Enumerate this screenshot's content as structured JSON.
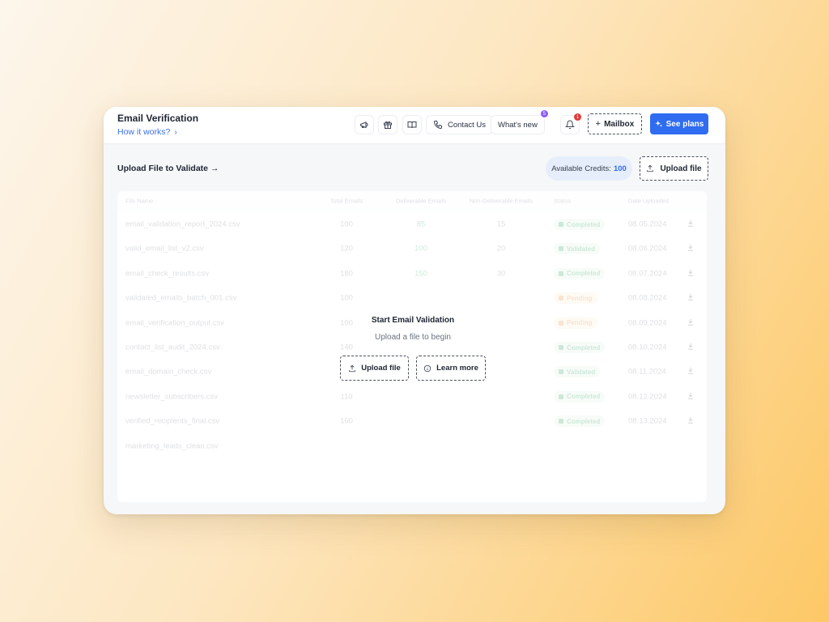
{
  "header": {
    "title": "Email Verification",
    "how_it_works": "How it works?",
    "contact_us": "Contact Us",
    "whats_new": "What's new",
    "whats_new_badge": "5",
    "notifications_badge": "1",
    "mailbox": "Mailbox",
    "see_plans": "See plans"
  },
  "toolbar": {
    "section_title": "Upload File to Validate →",
    "credits_label": "Available Credits:",
    "credits_value": "100",
    "upload_file": "Upload file"
  },
  "table": {
    "columns": [
      "File Name",
      "Total Emails",
      "Deliverable Emails",
      "Non-Deliverable Emails",
      "Status",
      "Date Uploaded",
      ""
    ],
    "rows": [
      {
        "name": "email_validation_report_2024.csv",
        "total": "100",
        "deliverable": "85",
        "non_deliverable": "15",
        "status": "Completed",
        "status_color": "green",
        "date": "08.05.2024"
      },
      {
        "name": "valid_email_list_v2.csv",
        "total": "120",
        "deliverable": "100",
        "non_deliverable": "20",
        "status": "Validated",
        "status_color": "green",
        "date": "08.06.2024"
      },
      {
        "name": "email_check_results.csv",
        "total": "180",
        "deliverable": "150",
        "non_deliverable": "30",
        "status": "Completed",
        "status_color": "green",
        "date": "08.07.2024"
      },
      {
        "name": "validated_emails_batch_001.csv",
        "total": "100",
        "deliverable": "",
        "non_deliverable": "",
        "status": "Pending",
        "status_color": "orange",
        "date": "08.08.2024"
      },
      {
        "name": "email_verification_output.csv",
        "total": "100",
        "deliverable": "",
        "non_deliverable": "",
        "status": "Pending",
        "status_color": "orange",
        "date": "08.09.2024"
      },
      {
        "name": "contact_list_audit_2024.csv",
        "total": "140",
        "deliverable": "",
        "non_deliverable": "",
        "status": "Completed",
        "status_color": "green",
        "date": "08.10.2024"
      },
      {
        "name": "email_domain_check.csv",
        "total": "150",
        "deliverable": "",
        "non_deliverable": "",
        "status": "Validated",
        "status_color": "green",
        "date": "08.11.2024"
      },
      {
        "name": "newsletter_subscribers.csv",
        "total": "110",
        "deliverable": "",
        "non_deliverable": "",
        "status": "Completed",
        "status_color": "green",
        "date": "08.12.2024"
      },
      {
        "name": "verified_recipients_final.csv",
        "total": "160",
        "deliverable": "",
        "non_deliverable": "",
        "status": "Completed",
        "status_color": "green",
        "date": "08.13.2024"
      },
      {
        "name": "marketing_leads_clean.csv",
        "total": "",
        "deliverable": "",
        "non_deliverable": "",
        "status": "",
        "status_color": "green",
        "date": ""
      }
    ]
  },
  "empty_state": {
    "title": "Start Email Validation",
    "subtitle": "Upload a file to begin",
    "upload_button": "Upload file",
    "learn_more_button": "Learn more"
  },
  "colors": {
    "accent": "#2f6cf0",
    "success": "#1f9a52",
    "pending": "#e08a2a",
    "badge_purple": "#8b5cf6",
    "badge_red": "#e03a3a"
  }
}
